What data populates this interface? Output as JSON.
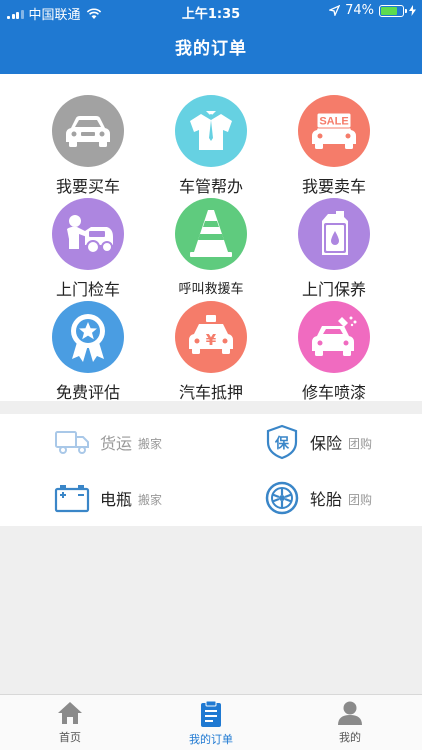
{
  "status_bar": {
    "carrier": "中国联通",
    "time": "上午1:35",
    "battery": "74%",
    "battery_level": 0.74
  },
  "header": {
    "title": "我的订单"
  },
  "services": [
    {
      "label": "我要买车",
      "icon": "car-icon",
      "color": "#a2a2a2"
    },
    {
      "label": "车管帮办",
      "icon": "shirt-icon",
      "color": "#66d1e2"
    },
    {
      "label": "我要卖车",
      "icon": "sale-car-icon",
      "color": "#f57c6a"
    },
    {
      "label": "上门检车",
      "icon": "mechanic-icon",
      "color": "#ad86e0"
    },
    {
      "label": "呼叫救援车",
      "icon": "traffic-cone-icon",
      "color": "#5fcb7e"
    },
    {
      "label": "上门保养",
      "icon": "oil-can-icon",
      "color": "#ad86e0"
    },
    {
      "label": "免费评估",
      "icon": "award-ribbon-icon",
      "color": "#4a9de2"
    },
    {
      "label": "汽车抵押",
      "icon": "yuan-car-icon",
      "color": "#f57c6a"
    },
    {
      "label": "修车喷漆",
      "icon": "spray-car-icon",
      "color": "#f06bc0"
    }
  ],
  "secondary": [
    {
      "name": "货运",
      "tag": "搬家",
      "icon": "truck-icon",
      "muted": true
    },
    {
      "name": "保险",
      "tag": "团购",
      "icon": "insurance-shield-icon",
      "muted": false
    },
    {
      "name": "电瓶",
      "tag": "搬家",
      "icon": "battery-icon",
      "muted": false
    },
    {
      "name": "轮胎",
      "tag": "团购",
      "icon": "tire-icon",
      "muted": false
    }
  ],
  "tabbar": {
    "items": [
      {
        "label": "首页",
        "icon": "home-icon",
        "active": false
      },
      {
        "label": "我的订单",
        "icon": "order-clipboard-icon",
        "active": true
      },
      {
        "label": "我的",
        "icon": "user-icon",
        "active": false
      }
    ]
  },
  "colors": {
    "primary": "#1f79d2",
    "background": "#efefef",
    "icon_blue": "#3a86c8"
  }
}
